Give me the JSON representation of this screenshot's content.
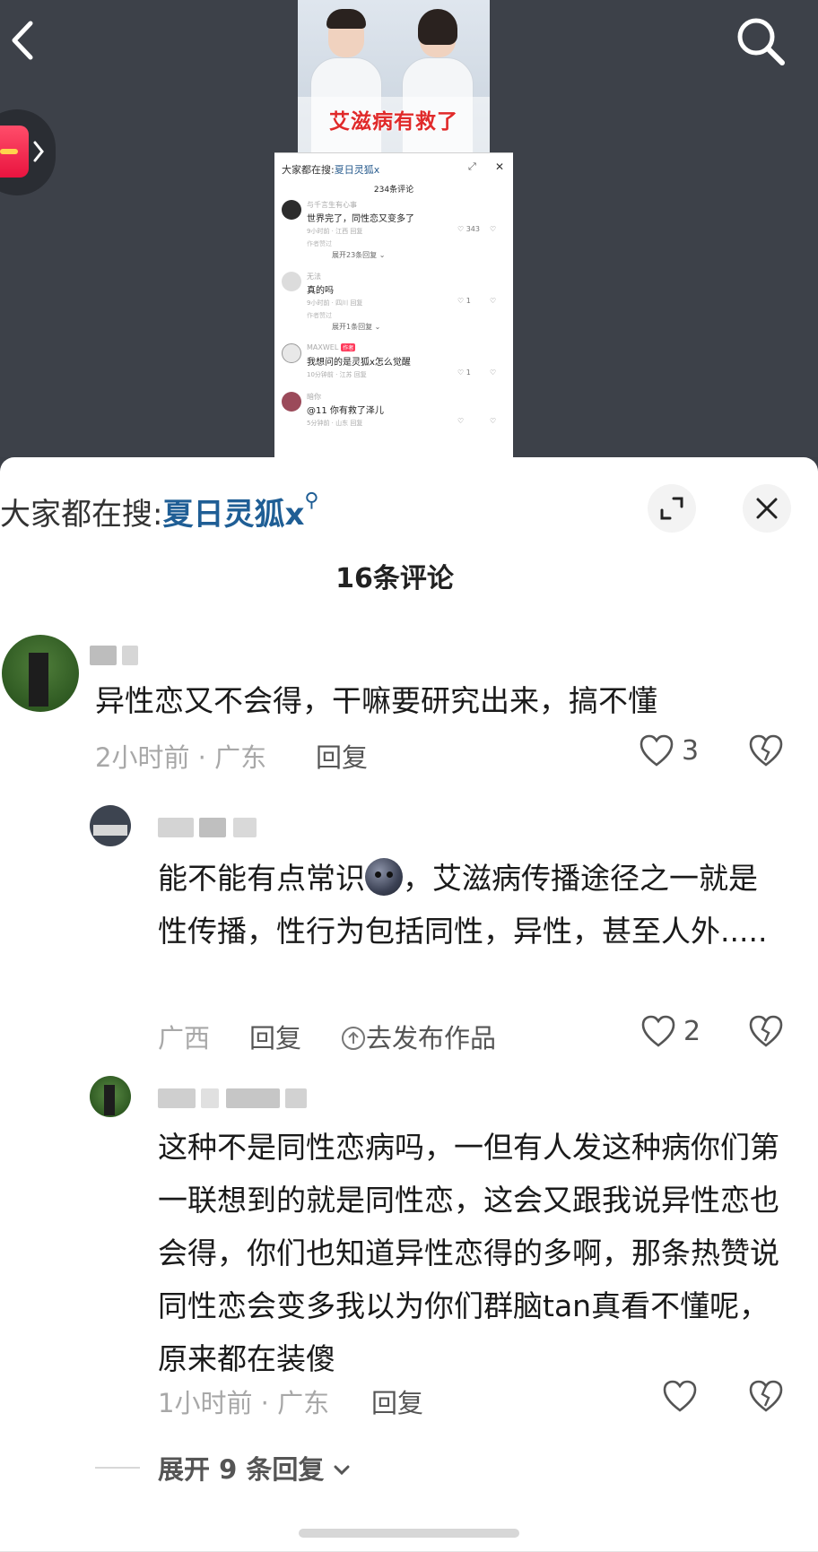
{
  "nav": {
    "back_icon": "chevron-left-icon",
    "search_icon": "search-icon",
    "gift_icon": "red-packet-icon"
  },
  "embedded_post": {
    "video_caption": "艾滋病有救了",
    "search_label": "大家都在搜:",
    "search_term": "夏日灵狐x",
    "comment_count": "234条评论",
    "comments": [
      {
        "name": "与千言生有心事",
        "text": "世界完了，同性恋又变多了",
        "meta": "9小时前 · 江西   回复",
        "likes": "343",
        "author_note": "作者赞过",
        "more": "展开23条回复"
      },
      {
        "name": "无法",
        "text": "真的吗",
        "meta": "9小时前 · 四川   回复",
        "likes": "1",
        "author_note": "作者赞过",
        "more": "展开1条回复"
      },
      {
        "name": "MAXWEL",
        "tag": "作者",
        "text": "我想问的是灵狐x怎么觉醒",
        "meta": "10分钟前 · 江苏   回复",
        "likes": "1"
      },
      {
        "name": "暗你",
        "text": "@11 你有救了泽儿",
        "meta": "5分钟前 · 山东   回复",
        "likes": ""
      }
    ]
  },
  "sheet": {
    "search_label": "大家都在搜:",
    "search_term": "夏日灵狐",
    "search_suffix": "x",
    "comment_count": "16条评论",
    "comments": [
      {
        "text": "异性恋又不会得，干嘛要研究出来，搞不懂",
        "time_location": "2小时前 · 广东",
        "reply": "回复",
        "likes": "3"
      },
      {
        "text_before_emoji": "能不能有点常识",
        "text_after_emoji": "，艾滋病传播途径之一就是性传播，性行为包括同性，异性，甚至人外.....",
        "time_location": "广西",
        "reply": "回复",
        "publish": "去发布作品",
        "likes": "2"
      },
      {
        "text": "这种不是同性恋病吗，一但有人发这种病你们第一联想到的就是同性恋，这会又跟我说异性恋也会得，你们也知道异性恋得的多啊，那条热赞说同性恋会变多我以为你们群脑tan真看不懂呢，原来都在装傻",
        "time_location": "1小时前 · 广东",
        "reply": "回复",
        "likes": ""
      }
    ],
    "expand_replies": "展开 9 条回复"
  },
  "colors": {
    "accent_link": "#1f5e95",
    "caption_red": "#e02a2a",
    "tag_red": "#ff3b5c"
  }
}
